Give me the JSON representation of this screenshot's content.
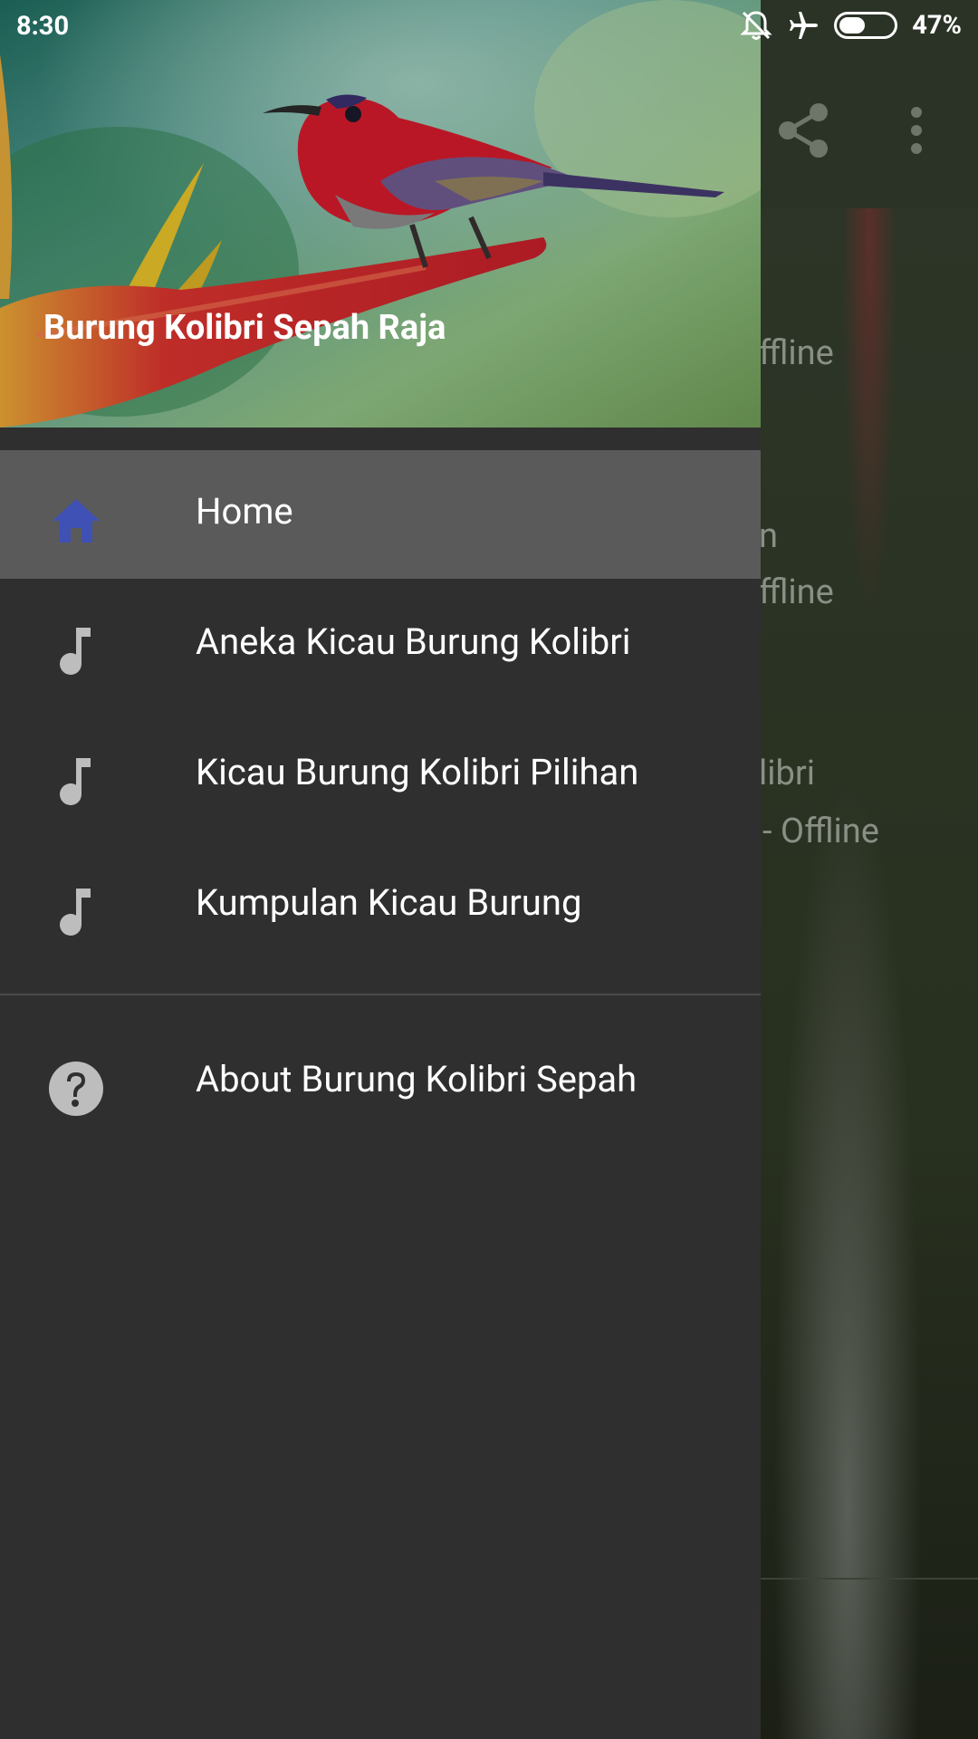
{
  "status_bar": {
    "time": "8:30",
    "battery_percent": "47%",
    "battery_level": 0.47,
    "icons": [
      "notifications-off-icon",
      "airplane-mode-icon",
      "battery-icon"
    ]
  },
  "background_app": {
    "toolbar_icons": [
      "share-icon",
      "more-vert-icon"
    ],
    "fragments": [
      "ffline",
      "n",
      "ffline",
      "libri",
      "- Offline"
    ]
  },
  "drawer": {
    "header": {
      "title": "Burung Kolibri Sepah Raja"
    },
    "items": [
      {
        "label": "Home",
        "icon": "home-icon",
        "selected": true
      },
      {
        "label": "Aneka Kicau Burung Kolibri",
        "icon": "music-note-icon",
        "selected": false
      },
      {
        "label": "Kicau Burung Kolibri Pilihan",
        "icon": "music-note-icon",
        "selected": false
      },
      {
        "label": "Kumpulan Kicau Burung",
        "icon": "music-note-icon",
        "selected": false
      },
      {
        "label": "About Burung Kolibri Sepah",
        "icon": "help-circle-icon",
        "selected": false
      }
    ]
  },
  "colors": {
    "drawer_bg": "#2f2f2f",
    "selected_bg": "#5a5a5a",
    "home_icon": "#3f51b5",
    "icon_gray": "#bdbdbd"
  }
}
